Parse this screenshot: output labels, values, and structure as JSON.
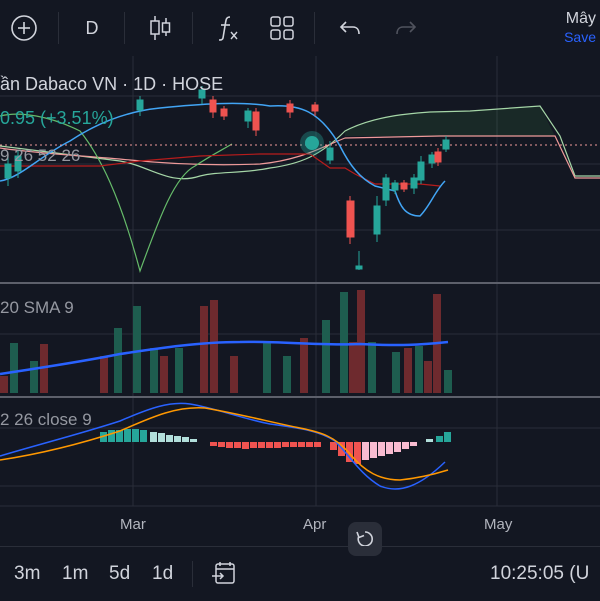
{
  "toolbar": {
    "interval": "D",
    "fx_label": "f",
    "cloud_label": "Mây",
    "save_label": "Save"
  },
  "legend": {
    "symbol_line": "ần Dabaco VN · 1D · HOSE",
    "change": "0.95 (+3.51%)",
    "ichimoku": "9 26 52 26",
    "volume": "20 SMA 9",
    "macd": "2 26 close 9"
  },
  "time_axis": {
    "labels": [
      "Mar",
      "Apr",
      "May"
    ]
  },
  "bottom": {
    "ranges": [
      "3m",
      "1m",
      "5d",
      "1d"
    ],
    "clock": "10:25:05 (U"
  },
  "colors": {
    "up": "#26a69a",
    "down": "#ef5350",
    "background": "#131722",
    "accent": "#2962ff"
  },
  "icons": {
    "add": "plus-circle-icon",
    "candles": "candlestick-icon",
    "indicators": "function-icon",
    "layout": "grid-icon",
    "undo": "undo-icon",
    "redo": "redo-icon",
    "date_range": "calendar-arrow-icon",
    "reset": "reset-icon"
  }
}
